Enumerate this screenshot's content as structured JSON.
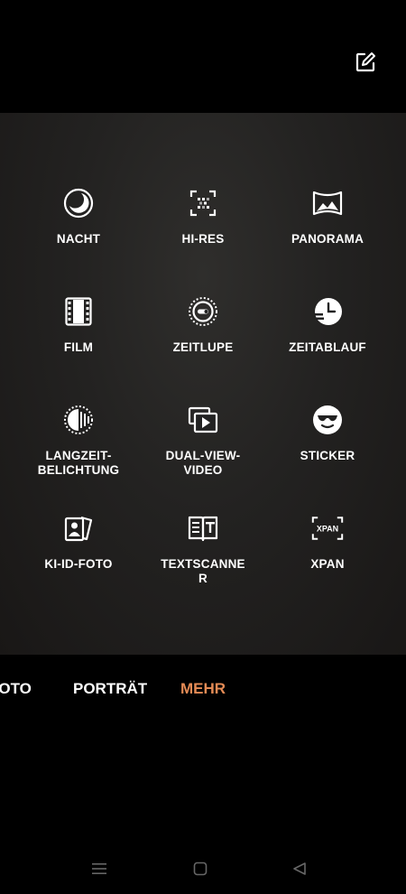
{
  "header": {
    "edit_icon": "edit-square-icon"
  },
  "modes": [
    {
      "label": "NACHT",
      "icon": "night-moon-icon"
    },
    {
      "label": "HI-RES",
      "icon": "hi-res-grid-icon"
    },
    {
      "label": "PANORAMA",
      "icon": "panorama-icon"
    },
    {
      "label": "FILM",
      "icon": "film-strip-icon"
    },
    {
      "label": "ZEITLUPE",
      "icon": "slow-motion-icon"
    },
    {
      "label": "ZEITABLAUF",
      "icon": "time-lapse-clock-icon"
    },
    {
      "label": "LANGZEIT-\nBELICHTUNG",
      "icon": "long-exposure-icon"
    },
    {
      "label": "DUAL-VIEW-\nVIDEO",
      "icon": "dual-view-video-icon"
    },
    {
      "label": "STICKER",
      "icon": "sticker-sunglasses-face-icon"
    },
    {
      "label": "KI-ID-FOTO",
      "icon": "id-photo-icon"
    },
    {
      "label": "TEXTSCANNE\nR",
      "icon": "text-scanner-icon"
    },
    {
      "label": "XPAN",
      "icon": "xpan-icon"
    }
  ],
  "tabs": [
    {
      "label": "FOTO",
      "active": false
    },
    {
      "label": "PORTRÄT",
      "active": false
    },
    {
      "label": "MEHR",
      "active": true
    }
  ],
  "nav": {
    "menu_icon": "menu-lines-icon",
    "home_icon": "home-square-icon",
    "back_icon": "back-triangle-icon"
  },
  "colors": {
    "accent": "#e58b55",
    "background": "#000000",
    "panel": "#262524"
  }
}
